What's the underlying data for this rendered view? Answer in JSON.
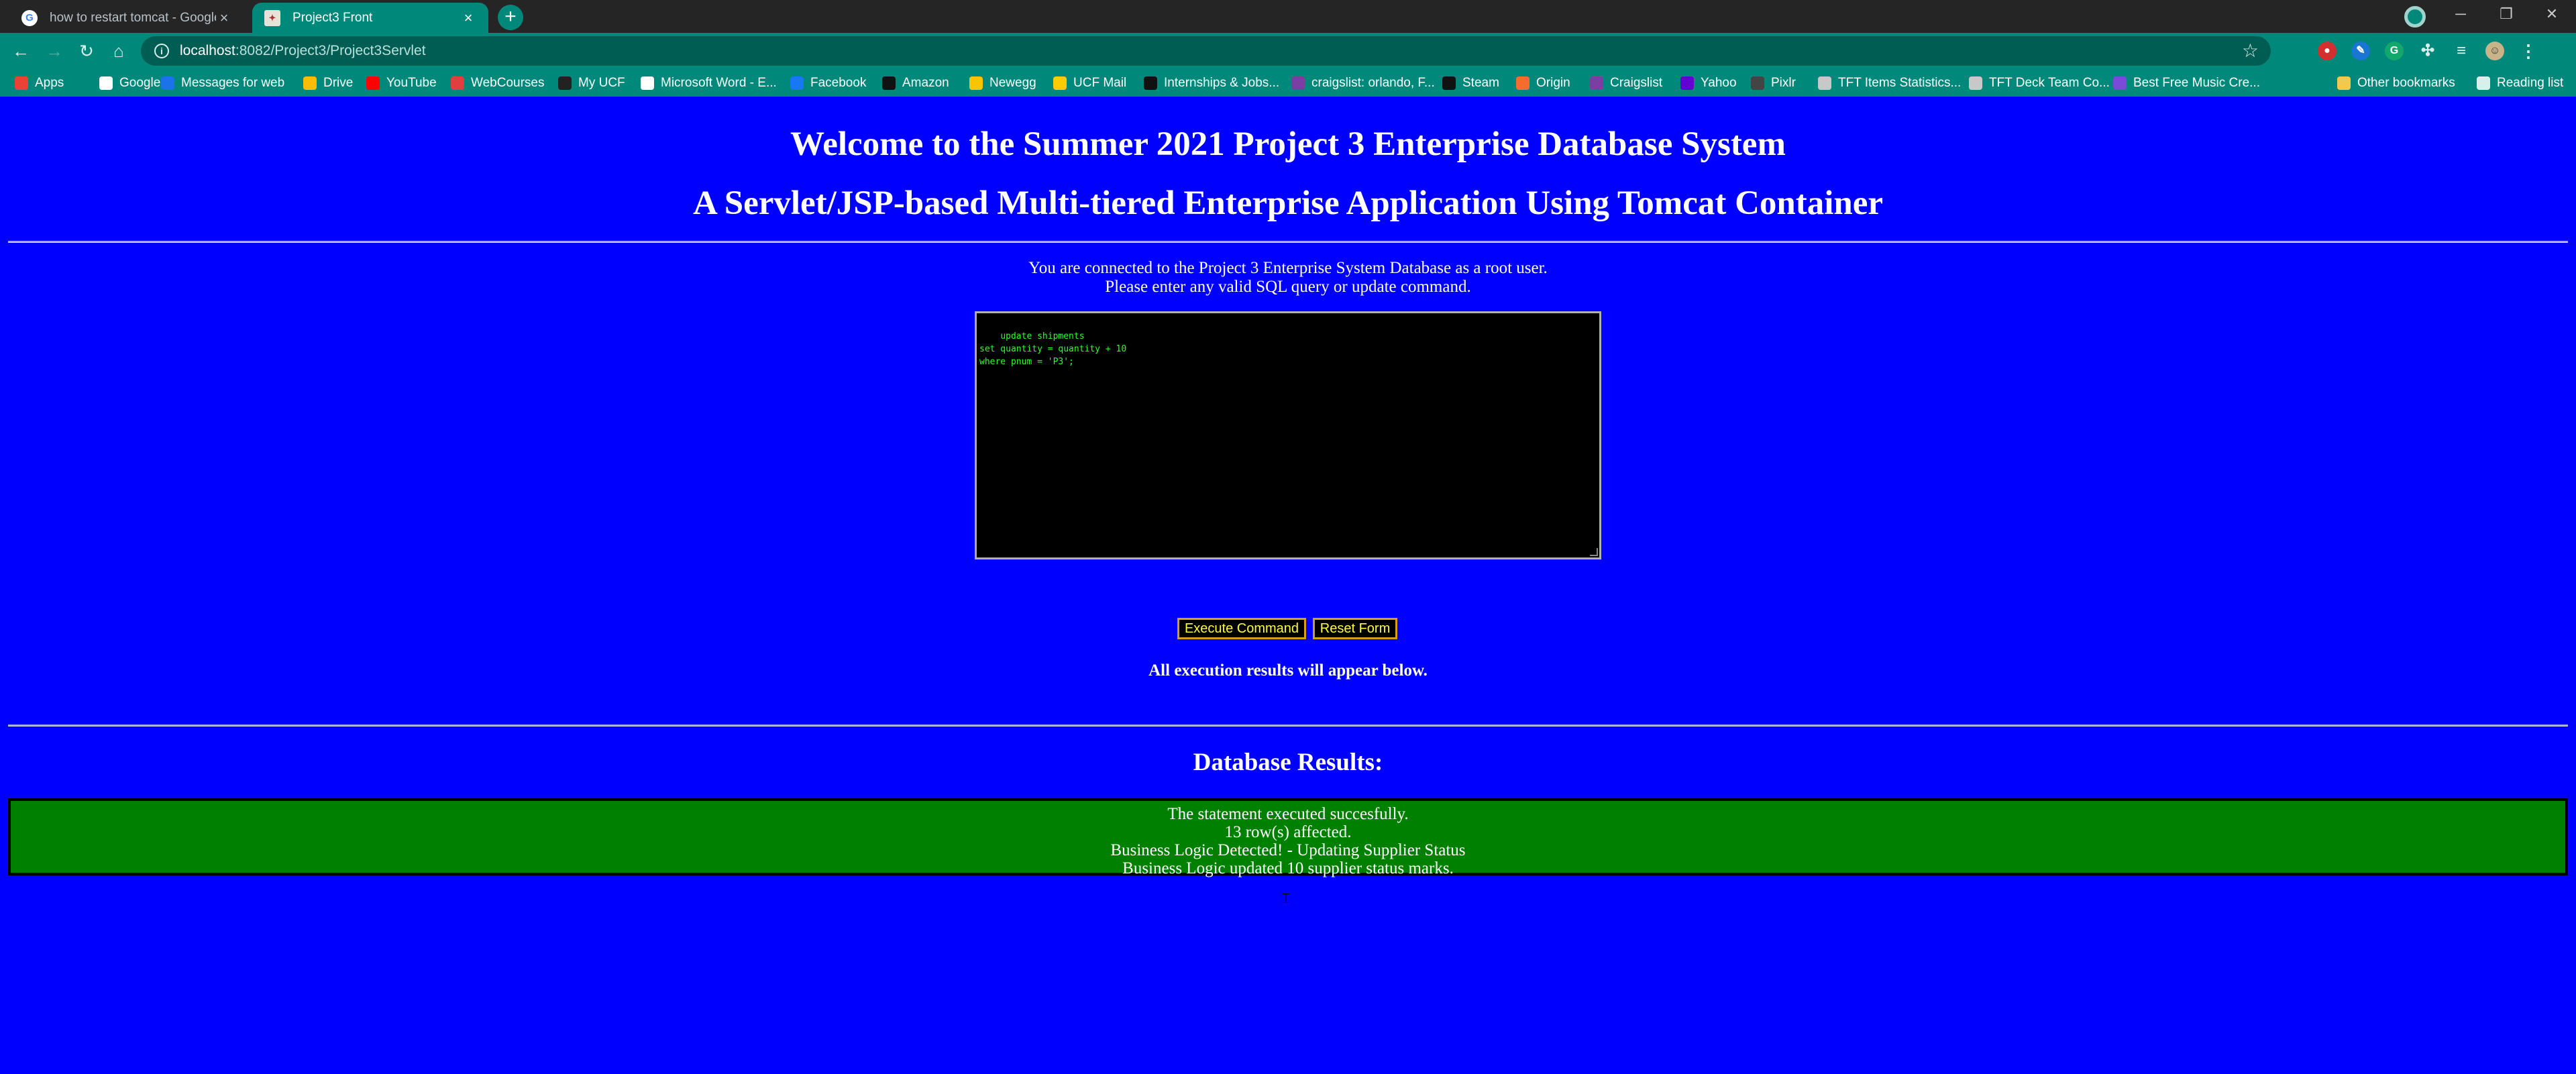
{
  "browser": {
    "tabs": [
      {
        "title": "how to restart tomcat - Google S",
        "active": false,
        "icon": "google-icon"
      },
      {
        "title": "Project3 Front",
        "active": true,
        "icon": "tomcat-icon"
      }
    ],
    "address": {
      "host": "localhost",
      "path": ":8082/Project3/Project3Servlet"
    },
    "bookmarks": [
      {
        "label": "Apps",
        "icon": "apps-grid-icon",
        "color": "#ea4335"
      },
      {
        "label": "Google",
        "icon": "google-icon",
        "color": "#ffffff"
      },
      {
        "label": "Messages for web",
        "icon": "messages-icon",
        "color": "#1a73e8"
      },
      {
        "label": "Drive",
        "icon": "drive-icon",
        "color": "#fbbc04"
      },
      {
        "label": "YouTube",
        "icon": "youtube-icon",
        "color": "#ff0000"
      },
      {
        "label": "WebCourses",
        "icon": "webcourses-icon",
        "color": "#e13f3f"
      },
      {
        "label": "My UCF",
        "icon": "ucf-icon",
        "color": "#222222"
      },
      {
        "label": "Microsoft Word - E...",
        "icon": "document-icon",
        "color": "#ffffff"
      },
      {
        "label": "Facebook",
        "icon": "facebook-icon",
        "color": "#1877f2"
      },
      {
        "label": "Amazon",
        "icon": "amazon-icon",
        "color": "#111111"
      },
      {
        "label": "Newegg",
        "icon": "newegg-icon",
        "color": "#f7c600"
      },
      {
        "label": "UCF Mail",
        "icon": "outlook-icon",
        "color": "#ffcc00"
      },
      {
        "label": "Internships & Jobs...",
        "icon": "handshake-icon",
        "color": "#111111"
      },
      {
        "label": "craigslist: orlando, F...",
        "icon": "craigslist-icon",
        "color": "#7b3fa3"
      },
      {
        "label": "Steam",
        "icon": "steam-icon",
        "color": "#111111"
      },
      {
        "label": "Origin",
        "icon": "origin-icon",
        "color": "#f56c2d"
      },
      {
        "label": "Craigslist",
        "icon": "craigslist-icon",
        "color": "#7b3fa3"
      },
      {
        "label": "Yahoo",
        "icon": "yahoo-icon",
        "color": "#6001d2"
      },
      {
        "label": "Pixlr",
        "icon": "pixlr-icon",
        "color": "#444444"
      },
      {
        "label": "TFT Items Statistics...",
        "icon": "tft-icon",
        "color": "#c8c8c8"
      },
      {
        "label": "TFT Deck Team Co...",
        "icon": "tft-icon",
        "color": "#c8c8c8"
      },
      {
        "label": "Best Free Music Cre...",
        "icon": "music-icon",
        "color": "#7a4bd8"
      },
      {
        "label": "Other bookmarks",
        "icon": "folder-icon",
        "color": "#f2c94c"
      },
      {
        "label": "Reading list",
        "icon": "reading-list-icon",
        "color": "#d8f0ec"
      }
    ]
  },
  "page": {
    "title": "Welcome to the Summer 2021 Project 3 Enterprise Database System",
    "subtitle": "A Servlet/JSP-based Multi-tiered Enterprise Application Using Tomcat Container",
    "intro_line1": "You are connected to the Project 3 Enterprise System Database as a root user.",
    "intro_line2": "Please enter any valid SQL query or update command.",
    "sql_text": "update shipments\nset quantity = quantity + 10\nwhere pnum = 'P3';",
    "execute_label": "Execute Command",
    "reset_label": "Reset Form",
    "results_note": "All execution results will appear below.",
    "results_title": "Database Results:",
    "results": {
      "line1": "The statement executed succesfully.",
      "line2": "13 row(s) affected.",
      "line3": "Business Logic Detected! - Updating Supplier Status",
      "line4": "Business Logic updated 10 supplier status marks."
    }
  },
  "colors": {
    "page_bg": "#0000ff",
    "results_bg": "#008000",
    "sql_text": "#2bff2b",
    "button_text": "#ffff33",
    "chrome_accent": "#00897b"
  }
}
